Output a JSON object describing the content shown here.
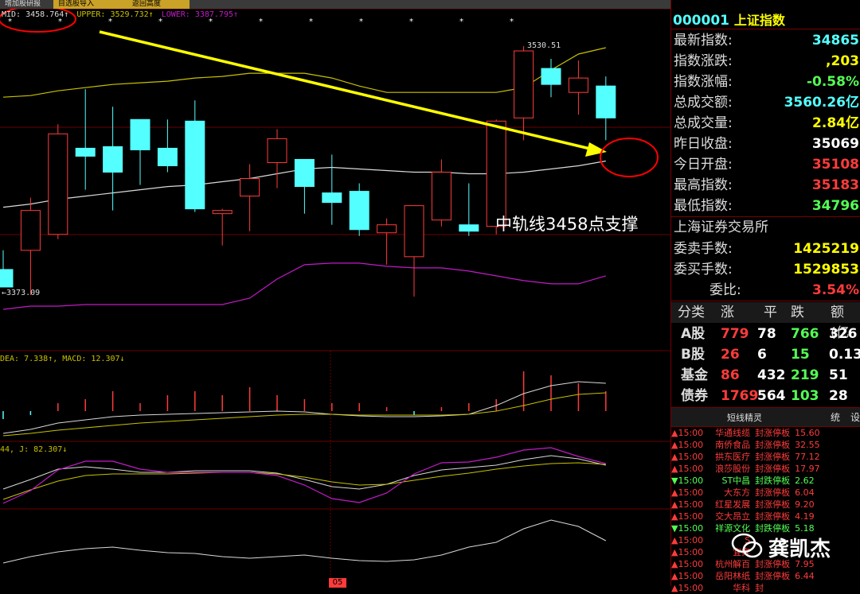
{
  "tabs": [
    "增加股研报",
    "目选股导入",
    "返回高度"
  ],
  "overlay": {
    "mid_label": "MID: ",
    "mid_value": "3458.764↑",
    "upper": "UPPER: 3529.732↑",
    "lower": "LOWER: 3387.795↑",
    "high_marker": "3530.51",
    "low_marker": "←3373.09",
    "annotation": "中轨线3458点支撑",
    "macd_label": "DEA: 7.338↑, MACD: 12.307↓",
    "kdj_label": "44, J: 82.307↓",
    "date_marker": "05"
  },
  "colors": {
    "up": "#ff3b3b",
    "down": "#54ffff",
    "upper": "#c8c100",
    "lower": "#c21bc7",
    "mid": "#d9d9d9",
    "arrow": "#ffff00",
    "circle": "#ff0000"
  },
  "candles": [
    {
      "o": 3391,
      "h": 3403,
      "l": 3381,
      "c": 3380
    },
    {
      "o": 3403,
      "h": 3436,
      "l": 3375,
      "c": 3428
    },
    {
      "o": 3413,
      "h": 3482,
      "l": 3410,
      "c": 3476
    },
    {
      "o": 3467,
      "h": 3504,
      "l": 3441,
      "c": 3462
    },
    {
      "o": 3468,
      "h": 3493,
      "l": 3428,
      "c": 3452
    },
    {
      "o": 3485,
      "h": 3485,
      "l": 3444,
      "c": 3466
    },
    {
      "o": 3467,
      "h": 3485,
      "l": 3452,
      "c": 3456
    },
    {
      "o": 3484,
      "h": 3497,
      "l": 3427,
      "c": 3429
    },
    {
      "o": 3426,
      "h": 3429,
      "l": 3406,
      "c": 3428
    },
    {
      "o": 3437,
      "h": 3457,
      "l": 3415,
      "c": 3448
    },
    {
      "o": 3458,
      "h": 3479,
      "l": 3442,
      "c": 3473
    },
    {
      "o": 3460,
      "h": 3460,
      "l": 3426,
      "c": 3443
    },
    {
      "o": 3439,
      "h": 3463,
      "l": 3419,
      "c": 3433
    },
    {
      "o": 3440,
      "h": 3445,
      "l": 3412,
      "c": 3416
    },
    {
      "o": 3414,
      "h": 3423,
      "l": 3394,
      "c": 3419
    },
    {
      "o": 3399,
      "h": 3430,
      "l": 3374,
      "c": 3431
    },
    {
      "o": 3422,
      "h": 3460,
      "l": 3418,
      "c": 3452
    },
    {
      "o": 3419,
      "h": 3445,
      "l": 3412,
      "c": 3415
    },
    {
      "o": 3418,
      "h": 3485,
      "l": 3413,
      "c": 3484
    },
    {
      "o": 3486,
      "h": 3531,
      "l": 3472,
      "c": 3528
    },
    {
      "o": 3517,
      "h": 3523,
      "l": 3499,
      "c": 3507
    },
    {
      "o": 3502,
      "h": 3522,
      "l": 3488,
      "c": 3511
    },
    {
      "o": 3506,
      "h": 3512,
      "l": 3472,
      "c": 3486
    }
  ],
  "bands": {
    "upper": [
      3499,
      3500,
      3503,
      3505,
      3507,
      3508,
      3509,
      3511,
      3512,
      3514,
      3514,
      3514,
      3511,
      3506,
      3502,
      3502,
      3502,
      3502,
      3502,
      3505,
      3516,
      3526,
      3530
    ],
    "mid": [
      3430,
      3432,
      3435,
      3437,
      3439,
      3441,
      3443,
      3444,
      3446,
      3448,
      3451,
      3454,
      3455,
      3454,
      3453,
      3452,
      3452,
      3451,
      3451,
      3452,
      3454,
      3456,
      3459
    ],
    "lower": [
      3366,
      3368,
      3368,
      3369,
      3369,
      3369,
      3369,
      3369,
      3369,
      3373,
      3385,
      3394,
      3395,
      3395,
      3393,
      3392,
      3392,
      3390,
      3387,
      3384,
      3382,
      3382,
      3387
    ]
  },
  "right_panel": {
    "title_code": "000001",
    "title_name": "上证指数",
    "rows": [
      {
        "k": "最新指数:",
        "v": "34865"
      },
      {
        "k": "指数涨跌:",
        "v": ",203"
      },
      {
        "k": "指数涨幅:",
        "v": "-0.58%"
      },
      {
        "k": "总成交额:",
        "v": "3560.26亿"
      },
      {
        "k": "总成交量:",
        "v": "2.84亿"
      },
      {
        "k": "昨日收盘:",
        "v": "35069"
      },
      {
        "k": "今日开盘:",
        "v": "35108"
      },
      {
        "k": "最高指数:",
        "v": "35183"
      },
      {
        "k": "最低指数:",
        "v": "34796"
      }
    ],
    "exchange": "上海证券交易所",
    "book": [
      {
        "k": "委卖手数:",
        "v": "1425219"
      },
      {
        "k": "委买手数:",
        "v": "1529853"
      },
      {
        "k": "委比:",
        "v": "3.54%"
      }
    ],
    "stats_headers": [
      "分类",
      "涨",
      "平",
      "跌",
      "额(亿"
    ],
    "stats": [
      {
        "cat": "A股",
        "up": "779",
        "flat": "78",
        "down": "766",
        "amt": "326"
      },
      {
        "cat": "B股",
        "up": "26",
        "flat": "6",
        "down": "15",
        "amt": "0.13"
      },
      {
        "cat": "基金",
        "up": "86",
        "flat": "432",
        "down": "219",
        "amt": "51"
      },
      {
        "cat": "债券",
        "up": "1769",
        "flat": "564",
        "down": "103",
        "amt": "28"
      }
    ],
    "bottom_tabs": [
      "短线精灵",
      "统",
      "设"
    ],
    "tickers": [
      {
        "arrow": "▲",
        "time": "15:00",
        "name": "华通线缆",
        "action": "封涨停板",
        "value": "15.60",
        "up": true
      },
      {
        "arrow": "▲",
        "time": "15:00",
        "name": "南侨食品",
        "action": "封涨停板",
        "value": "32.55",
        "up": true
      },
      {
        "arrow": "▲",
        "time": "15:00",
        "name": "拱东医疗",
        "action": "封涨停板",
        "value": "77.12",
        "up": true
      },
      {
        "arrow": "▲",
        "time": "15:00",
        "name": "浪莎股份",
        "action": "封涨停板",
        "value": "17.97",
        "up": true
      },
      {
        "arrow": "▼",
        "time": "15:00",
        "name": "ST中昌",
        "action": "封跌停板",
        "value": "2.62",
        "up": false
      },
      {
        "arrow": "▲",
        "time": "15:00",
        "name": "大东方",
        "action": "封涨停板",
        "value": "6.04",
        "up": true
      },
      {
        "arrow": "▲",
        "time": "15:00",
        "name": "红星发展",
        "action": "封涨停板",
        "value": "9.20",
        "up": true
      },
      {
        "arrow": "▲",
        "time": "15:00",
        "name": "交大昂立",
        "action": "封涨停板",
        "value": "4.19",
        "up": true
      },
      {
        "arrow": "▼",
        "time": "15:00",
        "name": "祥源文化",
        "action": "封跌停板",
        "value": "5.18",
        "up": false
      },
      {
        "arrow": "▲",
        "time": "15:00",
        "name": "S",
        "action": "",
        "value": "",
        "up": true
      },
      {
        "arrow": "▲",
        "time": "15:00",
        "name": "宜宾",
        "action": "",
        "value": "",
        "up": true
      },
      {
        "arrow": "▲",
        "time": "15:00",
        "name": "杭州解百",
        "action": "封涨停板",
        "value": "7.95",
        "up": true
      },
      {
        "arrow": "▲",
        "time": "15:00",
        "name": "岳阳林纸",
        "action": "封涨停板",
        "value": "6.44",
        "up": true
      },
      {
        "arrow": "▲",
        "time": "15:00",
        "name": "华科",
        "action": "封",
        "value": "",
        "up": true
      }
    ]
  },
  "watermark": "龚凯杰"
}
